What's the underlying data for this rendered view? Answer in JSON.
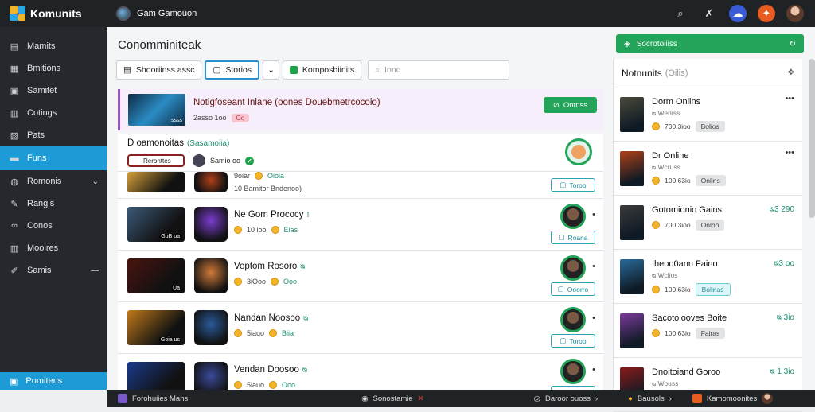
{
  "app": {
    "brand": "Komunits",
    "context_title": "Gam Gamouon"
  },
  "sidebar": {
    "items": [
      {
        "label": "Mamits",
        "icon": "home-icon"
      },
      {
        "label": "Bmitions",
        "icon": "grid-icon"
      },
      {
        "label": "Samitet",
        "icon": "box-icon"
      },
      {
        "label": "Cotings",
        "icon": "calendar-icon"
      },
      {
        "label": "Pats",
        "icon": "chart-icon"
      },
      {
        "label": "Funs",
        "icon": "folder-icon",
        "active": true
      },
      {
        "label": "Romonis",
        "icon": "people-icon",
        "chevron": "⌄"
      },
      {
        "label": "Rangls",
        "icon": "tag-icon"
      },
      {
        "label": "Conos",
        "icon": "link-icon"
      },
      {
        "label": "Mooires",
        "icon": "book-icon"
      },
      {
        "label": "Samis",
        "icon": "pin-icon",
        "chevron": "—"
      }
    ],
    "footer": "Pomitens"
  },
  "main": {
    "title": "Conomminiteak",
    "filters": {
      "shortlist": "Shooriinss assc",
      "stories": "Storios",
      "compost": "Komposbiinits",
      "search_placeholder": "Iond"
    },
    "featured": {
      "title": "Notigfoseant Inlane (oones Douebmetrcocoio)",
      "thumb_label": "ssss",
      "meta": "2asso 1oo",
      "badge": "Oo",
      "button": "Ontnss"
    },
    "section": {
      "title": "D oamonoitas",
      "tag": "(Sasamoiia)",
      "chip": "Reronttes",
      "user": "Samio oo"
    },
    "rows": [
      {
        "name": "",
        "tag": "",
        "m1": "9oiar",
        "m2": "Oioia",
        "m3": "10 Bamitor Bndenoo)",
        "button": "Toroo",
        "partial": true,
        "t1": "#d7a03a",
        "t2": "#b0401a"
      },
      {
        "name": "Ne Gom Prococy",
        "tag": "!",
        "m1": "10 ioo",
        "m2": "Eias",
        "thumb_label": "GuB ua",
        "button": "Roana",
        "t1": "#3c5a7a",
        "t2": "#7a3ccf"
      },
      {
        "name": "Veptom Rosoro",
        "tag": "ᴓ",
        "m1": "3iOoo",
        "m2": "Ooo",
        "thumb_label": "Ua",
        "button": "Ooorro",
        "t1": "#4a1410",
        "t2": "#d07a3a"
      },
      {
        "name": "Nandan Noosoo",
        "tag": "ᴓ",
        "m1": "5iauo",
        "m2": "Biia",
        "thumb_label": "Goia us",
        "button": "Toroo",
        "t1": "#c07a1a",
        "t2": "#2a5a9a"
      },
      {
        "name": "Vendan Doosoo",
        "tag": "ᴓ",
        "m1": "5iauo",
        "m2": "Ooo",
        "thumb_label": "",
        "button": "Toroo",
        "t1": "#1a3a8a",
        "t2": "#3a4a9a"
      }
    ]
  },
  "right": {
    "top_label": "Socrotoiiiss",
    "panel_title": "Notnunits",
    "panel_sub": "(Oilis)",
    "items": [
      {
        "title": "Dorm Onlins",
        "sub": "ᴓ Wehiss",
        "m": "700.3ioo",
        "pill": "Bolios",
        "corner": "•••",
        "t": "#4a4a3a"
      },
      {
        "title": "Dr Online",
        "sub": "ᴓ Wcruss",
        "m": "100.63io",
        "pill": "Onlins",
        "corner": "•••",
        "t": "#b0401a"
      },
      {
        "title": "Gotomionio Gains",
        "sub": "",
        "m": "700.3ioo",
        "pill": "Onloo",
        "corner": "ᴓ3 290",
        "t": "#3a3a3a"
      },
      {
        "title": "Iheoo0ann Faino",
        "sub": "ᴓ Wciios",
        "m": "100.63io",
        "pill": "Bolinas",
        "corner": "ᴓ3 oo",
        "teal": true,
        "t": "#2a6a9a"
      },
      {
        "title": "Sacotoiooves Boite",
        "sub": "",
        "m": "100.63io",
        "pill": "Fairas",
        "corner": "ᴓ 3io",
        "t": "#7a3a9a"
      },
      {
        "title": "Dnoitoiand Goroo",
        "sub": "ᴓ Wouss",
        "m": "",
        "pill": "",
        "corner": "ᴓ 1 3io",
        "t": "#8a1a1a"
      }
    ]
  },
  "bottom": {
    "b1": "Forohuiies Mahs",
    "b2": "Sonostamie",
    "b3": "Daroor ouoss",
    "b4": "Bausols",
    "b5": "Kamomoonites"
  }
}
